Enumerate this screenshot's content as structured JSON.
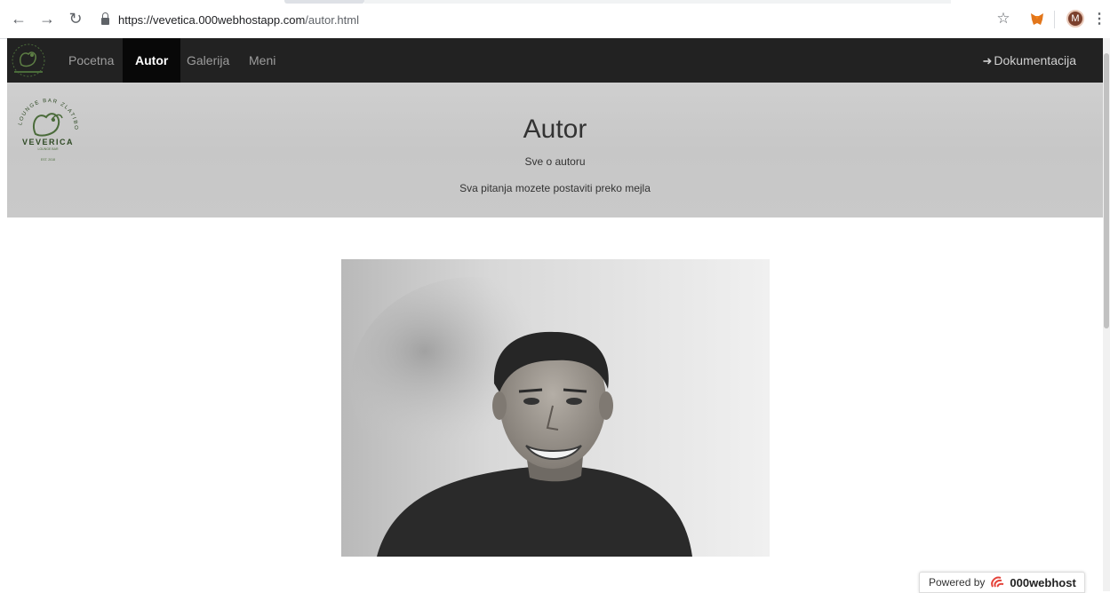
{
  "browser": {
    "url_host": "https://vevetica.000webhostapp.com",
    "url_path": "/autor.html",
    "profile_initial": "M"
  },
  "navbar": {
    "items": [
      {
        "label": "Pocetna",
        "active": false
      },
      {
        "label": "Autor",
        "active": true
      },
      {
        "label": "Galerija",
        "active": false
      },
      {
        "label": "Meni",
        "active": false
      }
    ],
    "right_link": "Dokumentacija",
    "right_icon": "log-in-icon"
  },
  "hero": {
    "title": "Autor",
    "subtitle": "Sve o autoru",
    "note": "Sva pitanja mozete postaviti preko mejla"
  },
  "logo": {
    "brand": "VEVERICA",
    "arc_text": "LOUNGE BAR ZLATIBOR",
    "small": "LOUNGE BAR",
    "est": "EST. 2018"
  },
  "footer_badge": {
    "prefix": "Powered by",
    "brand": "000webhost"
  },
  "colors": {
    "navbar_bg": "#222222",
    "navbar_active": "#080808",
    "jumbotron_bg": "#cccccc",
    "logo_green": "#4a6b3a"
  }
}
